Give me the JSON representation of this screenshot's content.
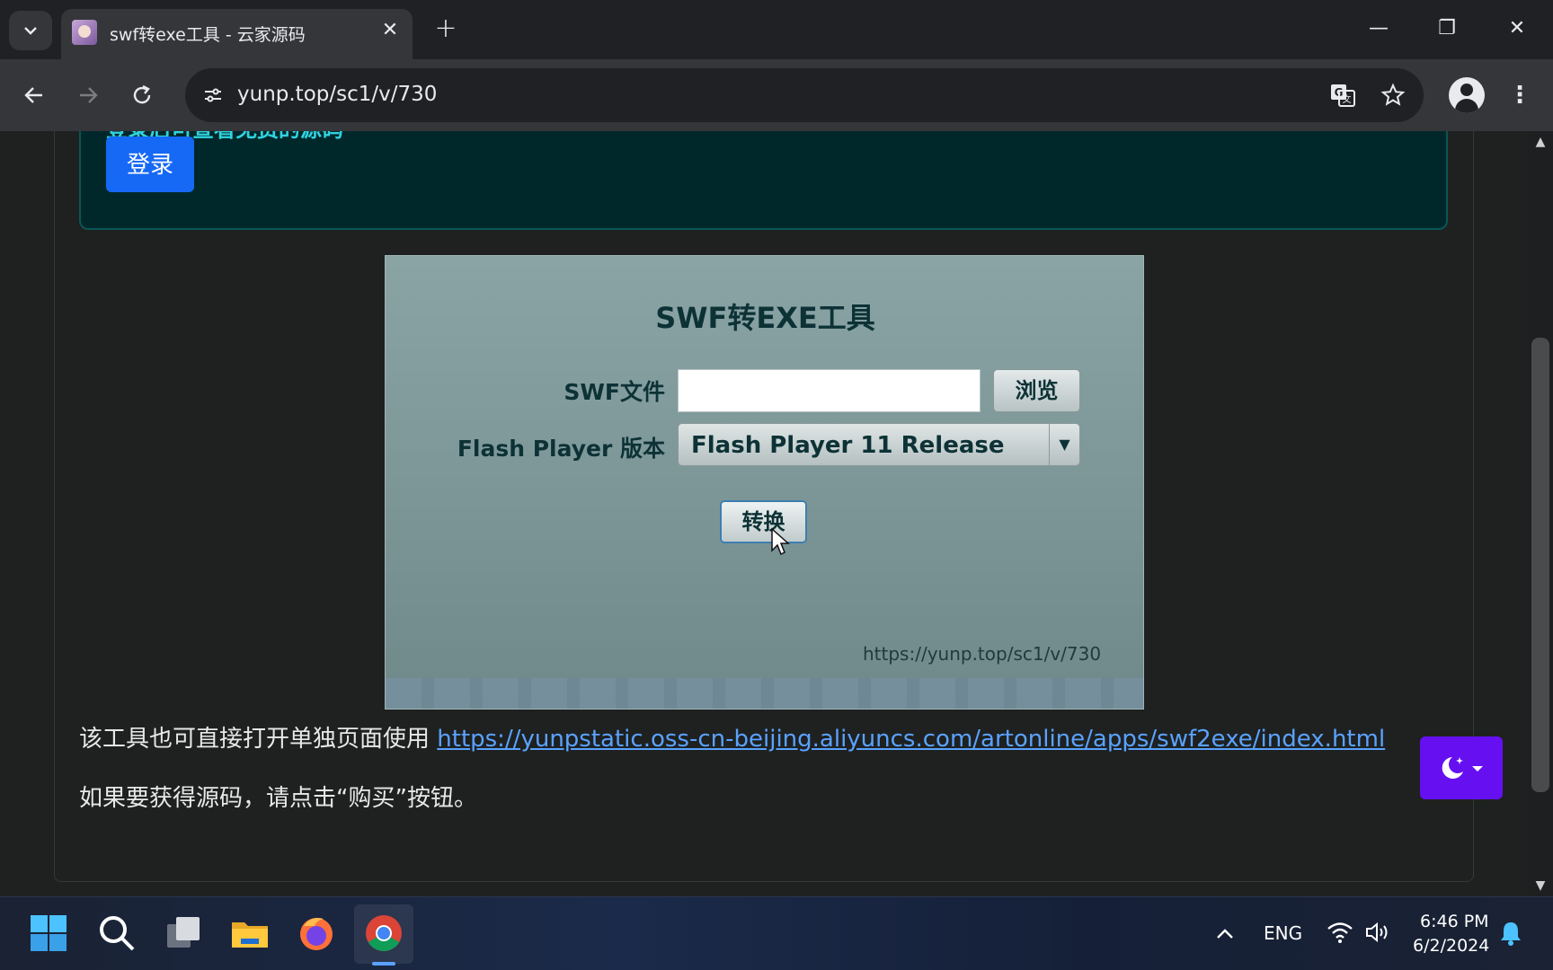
{
  "browser": {
    "tab_title": "swf转exe工具 - 云家源码",
    "tab_close": "✕",
    "new_tab": "+",
    "url": "yunp.top/sc1/v/730",
    "window": {
      "minimize": "—",
      "restore": "❐",
      "close": "✕"
    }
  },
  "page": {
    "login_hint": "登录后可查看免费的源码",
    "login_button": "登录",
    "tool": {
      "title": "SWF转EXE工具",
      "swf_label": "SWF文件",
      "swf_value": "",
      "browse_button": "浏览",
      "player_label": "Flash Player 版本",
      "player_selected": "Flash Player 11 Release",
      "convert_button": "转换",
      "url_text": "https://yunp.top/sc1/v/730"
    },
    "para1_text": "该工具也可直接打开单独页面使用 ",
    "para1_link": "https://yunpstatic.oss-cn-beijing.aliyuncs.com/artonline/apps/swf2exe/index.html",
    "para2_text": "如果要获得源码，请点击“购买”按钮。"
  },
  "taskbar": {
    "language": "ENG",
    "time": "6:46 PM",
    "date": "6/2/2024"
  },
  "colors": {
    "accent_blue": "#1669f5",
    "theme_purple": "#6610f2",
    "link": "#5aa2ff",
    "login_hint": "#2fd4e0"
  }
}
